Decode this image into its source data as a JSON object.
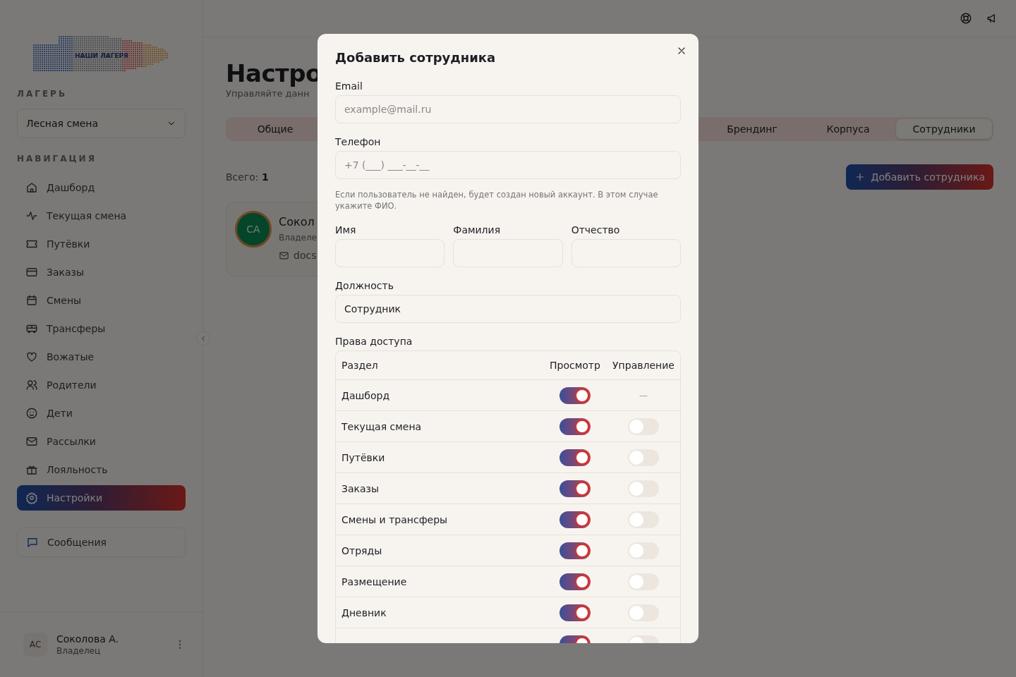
{
  "logo": {
    "text": "НАШИ ЛАГЕРЯ"
  },
  "sidebar": {
    "camp_label": "ЛАГЕРЬ",
    "camp_select": "Лесная смена",
    "nav_label": "НАВИГАЦИЯ",
    "items": [
      {
        "label": "Дашборд",
        "kind": "home",
        "selected": false
      },
      {
        "label": "Текущая смена",
        "kind": "pulse",
        "selected": false
      },
      {
        "label": "Путёвки",
        "kind": "ticket",
        "selected": false
      },
      {
        "label": "Заказы",
        "kind": "card",
        "selected": false
      },
      {
        "label": "Смены",
        "kind": "calendar",
        "selected": false
      },
      {
        "label": "Трансферы",
        "kind": "bus",
        "selected": false
      },
      {
        "label": "Вожатые",
        "kind": "heart",
        "selected": false
      },
      {
        "label": "Родители",
        "kind": "users",
        "selected": false
      },
      {
        "label": "Дети",
        "kind": "smile",
        "selected": false
      },
      {
        "label": "Рассылки",
        "kind": "mail",
        "selected": false
      },
      {
        "label": "Лояльность",
        "kind": "gift",
        "selected": false
      },
      {
        "label": "Настройки",
        "kind": "gear",
        "selected": true
      }
    ],
    "messages": {
      "label": "Сообщения"
    },
    "user": {
      "initials": "АС",
      "name": "Соколова А.",
      "role": "Владелец"
    }
  },
  "page": {
    "title": "Настро",
    "subtitle": "Управляйте данн",
    "tabs": [
      {
        "label": "Общие",
        "selected": false
      },
      {
        "label": "Брендинг",
        "selected": false
      },
      {
        "label": "Корпуса",
        "selected": false
      },
      {
        "label": "Сотрудники",
        "selected": true
      }
    ],
    "total_label": "Всего:",
    "total_value": "1",
    "add_button": "Добавить сотрудника",
    "employee": {
      "initials": "СА",
      "name": "Сокол",
      "role": "Владеле",
      "email": "docs"
    }
  },
  "modal": {
    "title": "Добавить сотрудника",
    "email": {
      "label": "Email",
      "placeholder": "example@mail.ru"
    },
    "phone": {
      "label": "Телефон",
      "placeholder": "+7 (___) ___-__-__"
    },
    "hint": "Если пользователь не найден, будет создан новый аккаунт. В этом случае укажите ФИО.",
    "name_fields": [
      {
        "label": "Имя"
      },
      {
        "label": "Фамилия"
      },
      {
        "label": "Отчество"
      }
    ],
    "position": {
      "label": "Должность",
      "value": "Сотрудник"
    },
    "permissions": {
      "label": "Права доступа",
      "columns": [
        "Раздел",
        "Просмотр",
        "Управление"
      ],
      "rows": [
        {
          "name": "Дашборд",
          "view": true,
          "manage_text": "—"
        },
        {
          "name": "Текущая смена",
          "view": true,
          "manage": false
        },
        {
          "name": "Путёвки",
          "view": true,
          "manage": false
        },
        {
          "name": "Заказы",
          "view": true,
          "manage": false
        },
        {
          "name": "Смены и трансферы",
          "view": true,
          "manage": false
        },
        {
          "name": "Отряды",
          "view": true,
          "manage": false
        },
        {
          "name": "Размещение",
          "view": true,
          "manage": false
        },
        {
          "name": "Дневник",
          "view": true,
          "manage": false
        },
        {
          "view": true,
          "manage": false
        }
      ]
    }
  }
}
